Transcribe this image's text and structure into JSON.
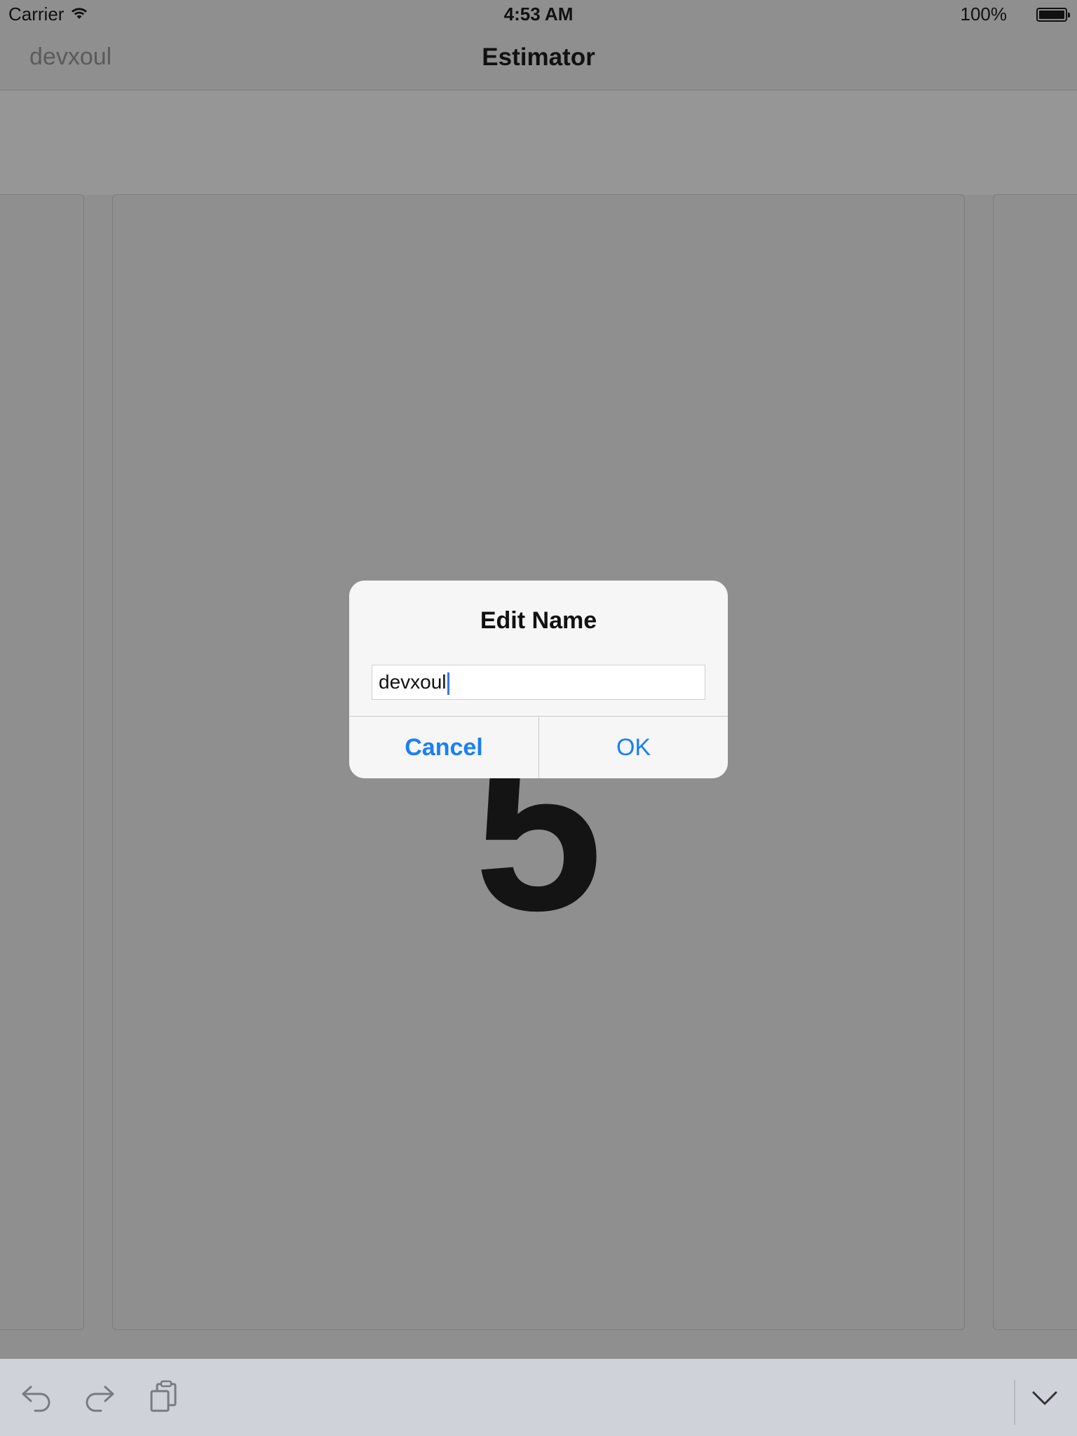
{
  "status_bar": {
    "carrier": "Carrier",
    "time": "4:53 AM",
    "battery": "100%"
  },
  "nav": {
    "back_label": "devxoul",
    "title": "Estimator"
  },
  "card": {
    "value": "5"
  },
  "alert": {
    "title": "Edit Name",
    "field_value": "devxoul",
    "cancel_label": "Cancel",
    "ok_label": "OK",
    "button_color": "#1a7ff5"
  },
  "toolbar": {
    "icons": [
      "undo-icon",
      "redo-icon",
      "paste-icon",
      "keyboard-dismiss-icon"
    ]
  }
}
